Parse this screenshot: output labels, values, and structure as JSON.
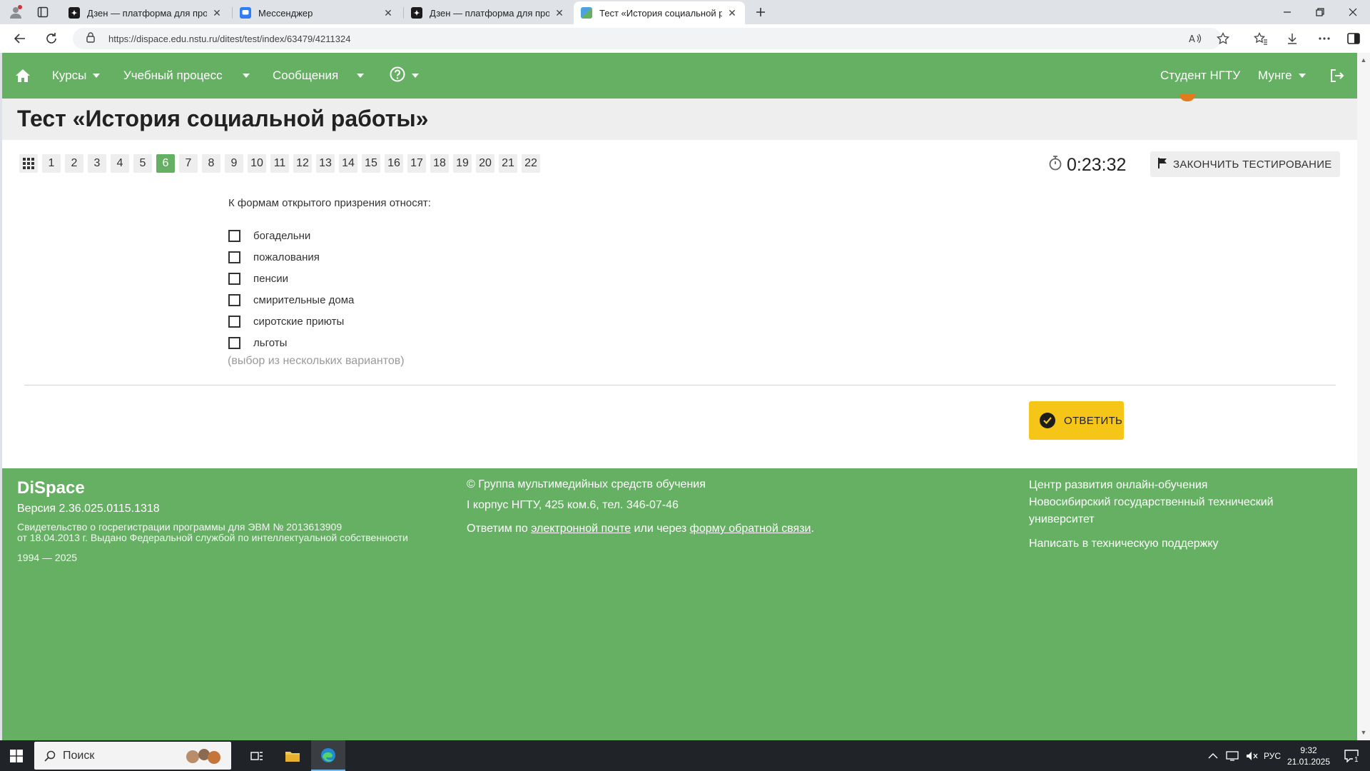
{
  "browser": {
    "tabs": [
      {
        "label": "Дзен — платформа для просмотра",
        "favicon": "dzen-icon",
        "active": false
      },
      {
        "label": "Мессенджер",
        "favicon": "messenger-icon",
        "active": false
      },
      {
        "label": "Дзен — платформа для просмотра",
        "favicon": "dzen-icon",
        "active": false
      },
      {
        "label": "Тест «История социальной работы»",
        "favicon": "dispace-icon",
        "active": true
      }
    ],
    "url": "https://dispace.edu.nstu.ru/ditest/test/index/63479/4211324"
  },
  "navbar": {
    "courses": "Курсы",
    "study_process": "Учебный процесс",
    "messages": "Сообщения",
    "user_org": "Студент НГТУ",
    "user_name": "Мунге"
  },
  "page": {
    "title": "Тест «История социальной работы»"
  },
  "test": {
    "questions": [
      "1",
      "2",
      "3",
      "4",
      "5",
      "6",
      "7",
      "8",
      "9",
      "10",
      "11",
      "12",
      "13",
      "14",
      "15",
      "16",
      "17",
      "18",
      "19",
      "20",
      "21",
      "22"
    ],
    "current_question": "6",
    "timer": "0:23:32",
    "finish_label": "ЗАКОНЧИТЬ ТЕСТИРОВАНИЕ",
    "question_text": "К формам открытого призрения относят:",
    "options": [
      "богадельни",
      "пожалования",
      "пенсии",
      "смирительные дома",
      "сиротские приюты",
      "льготы"
    ],
    "hint": "(выбор из нескольких вариантов)",
    "answer_label": "ОТВЕТИТЬ"
  },
  "footer": {
    "brand": "DiSpace",
    "version": "Версия 2.36.025.0115.1318",
    "cert_line1": "Свидетельство о госрегистрации программы для ЭВМ № 2013613909",
    "cert_line2": "от 18.04.2013 г. Выдано Федеральной службой по интеллектуальной собственности",
    "years": "1994 — 2025",
    "group": "© Группа мультимедийных средств обучения",
    "address": "I корпус НГТУ, 425 ком.6, тел. 346-07-46",
    "contact_prefix": "Ответим по",
    "contact_email_link": "электронной почте",
    "contact_middle": "или через",
    "contact_form_link": "форму обратной связи",
    "contact_suffix": ".",
    "link_center": "Центр развития онлайн-обучения",
    "link_univ_1": "Новосибирский государственный технический",
    "link_univ_2": "университет",
    "link_support": "Написать в техническую поддержку"
  },
  "taskbar": {
    "search_placeholder": "Поиск",
    "lang": "РУС",
    "time": "9:32",
    "date": "21.01.2025",
    "notifications": "1"
  },
  "colors": {
    "brand_green": "#66b064",
    "accent_yellow": "#f5c518",
    "header_gray": "#eeeeee"
  }
}
